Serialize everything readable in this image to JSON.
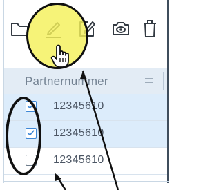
{
  "toolbar": {
    "buttons": [
      {
        "name": "folder-icon"
      },
      {
        "name": "edit-icon"
      },
      {
        "name": "edit-document-icon"
      },
      {
        "name": "preview-icon"
      },
      {
        "name": "delete-icon"
      }
    ]
  },
  "table": {
    "column_header": "Partnernummer",
    "rows": [
      {
        "value": "12345610",
        "checked": true
      },
      {
        "value": "12345610",
        "checked": true
      },
      {
        "value": "12345610",
        "checked": false
      }
    ]
  },
  "annotations": {
    "highlight_color": "#f4f05a",
    "outline_color": "#101010",
    "selected_row_color": "#dcecfb"
  }
}
